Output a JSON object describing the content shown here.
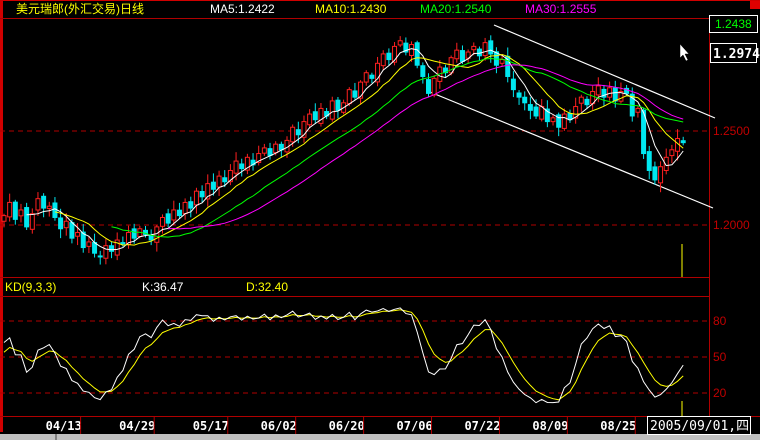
{
  "header": {
    "title": "美元瑞郎(外汇交易)日线",
    "ma5": "MA5:1.2422",
    "ma10": "MA10:1.2430",
    "ma20": "MA20:1.2540",
    "ma30": "MA30:1.2555"
  },
  "price_boxes": {
    "current": "1.2438",
    "cursor": "1.2974"
  },
  "kd_header": {
    "label": "KD(9,3,3)",
    "k": "K:36.47",
    "d": "D:32.40"
  },
  "cursor_date": "2005/09/01,四",
  "colors": {
    "up": "#ff2020",
    "down": "#00e8f0",
    "ma5": "#ffffff",
    "ma10": "#ffff00",
    "ma20": "#00ff00",
    "ma30": "#ff00ff",
    "grid": "#b00000",
    "k": "#ffffff",
    "d": "#ffff00"
  },
  "chart_data": [
    {
      "type": "candlestick",
      "title": "美元瑞郎(外汇交易)日线",
      "ylim": [
        1.17,
        1.31
      ],
      "yticks": [
        "1.2500",
        "1.2000"
      ],
      "yticks_values": [
        1.25,
        1.2
      ],
      "xticks": [
        "04/13",
        "04/29",
        "05/17",
        "06/02",
        "06/20",
        "07/06",
        "07/22",
        "08/09",
        "08/25"
      ],
      "closes": [
        1.205,
        1.212,
        1.203,
        1.208,
        1.199,
        1.206,
        1.214,
        1.209,
        1.21,
        1.204,
        1.198,
        1.202,
        1.193,
        1.196,
        1.188,
        1.191,
        1.185,
        1.183,
        1.189,
        1.186,
        1.192,
        1.19,
        1.196,
        1.193,
        1.198,
        1.195,
        1.192,
        1.199,
        1.204,
        1.201,
        1.208,
        1.205,
        1.212,
        1.209,
        1.218,
        1.215,
        1.222,
        1.219,
        1.226,
        1.223,
        1.229,
        1.234,
        1.23,
        1.236,
        1.232,
        1.238,
        1.241,
        1.237,
        1.243,
        1.24,
        1.245,
        1.252,
        1.248,
        1.255,
        1.259,
        1.256,
        1.262,
        1.258,
        1.266,
        1.261,
        1.265,
        1.272,
        1.268,
        1.276,
        1.281,
        1.278,
        1.286,
        1.291,
        1.288,
        1.295,
        1.298,
        1.292,
        1.296,
        1.285,
        1.279,
        1.27,
        1.278,
        1.284,
        1.281,
        1.289,
        1.293,
        1.287,
        1.292,
        1.295,
        1.29,
        1.297,
        1.291,
        1.285,
        1.288,
        1.279,
        1.272,
        1.268,
        1.265,
        1.261,
        1.258,
        1.263,
        1.255,
        1.257,
        1.252,
        1.259,
        1.256,
        1.263,
        1.268,
        1.264,
        1.271,
        1.274,
        1.268,
        1.273,
        1.266,
        1.271,
        1.27,
        1.258,
        1.262,
        1.238,
        1.229,
        1.224,
        1.231,
        1.236,
        1.24,
        1.246,
        1.2438
      ],
      "moving_averages": [
        {
          "name": "MA5",
          "period": 5,
          "last": 1.2422
        },
        {
          "name": "MA10",
          "period": 10,
          "last": 1.243
        },
        {
          "name": "MA20",
          "period": 20,
          "last": 1.254
        },
        {
          "name": "MA30",
          "period": 30,
          "last": 1.2555
        }
      ]
    },
    {
      "type": "line",
      "title": "KD(9,3,3)",
      "ylim": [
        0,
        100
      ],
      "yticks": [
        "80",
        "50",
        "20"
      ],
      "yticks_values": [
        80,
        50,
        20
      ],
      "series": [
        {
          "name": "K",
          "last": 36.47
        },
        {
          "name": "D",
          "last": 32.4
        }
      ]
    }
  ]
}
